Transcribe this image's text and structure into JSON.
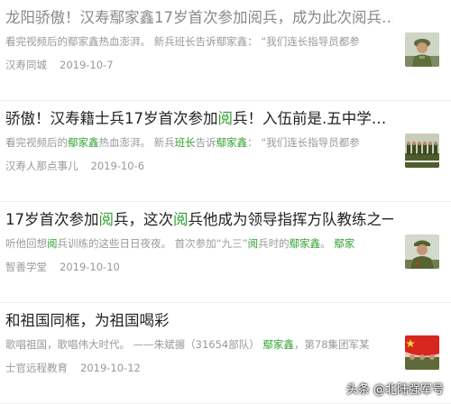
{
  "feed": {
    "items": [
      {
        "title_parts": [
          {
            "text": "龙阳骄傲！汉寿鄢家鑫17岁首次参加阅兵，成为此次阅兵…",
            "hl": false
          }
        ],
        "title_visited": true,
        "snippet_parts": [
          {
            "text": "看完视频后的鄢家鑫热血澎湃。  新兵班长告诉鄢家鑫：  “我们连长指导员都参",
            "hl": false
          }
        ],
        "source": "汉寿同城",
        "date": "2019-10-7",
        "thumb_icon": "soldier-photo-icon"
      },
      {
        "title_parts": [
          {
            "text": "骄傲！汉寿籍士兵17岁首次参加",
            "hl": false
          },
          {
            "text": "阅",
            "hl": true
          },
          {
            "text": "兵！入伍前是.五中学…",
            "hl": false
          }
        ],
        "title_visited": false,
        "snippet_parts": [
          {
            "text": "看完视频后的",
            "hl": false
          },
          {
            "text": "鄢家鑫",
            "hl": true
          },
          {
            "text": "热血澎湃。  新兵",
            "hl": false
          },
          {
            "text": "班长",
            "hl": true
          },
          {
            "text": "告诉",
            "hl": false
          },
          {
            "text": "鄢家鑫",
            "hl": true
          },
          {
            "text": "：  “我们连长指导员都参",
            "hl": false
          }
        ],
        "source": "汉寿人那点事儿",
        "date": "2019-10-6",
        "thumb_icon": "parade-formation-photo-icon"
      },
      {
        "title_parts": [
          {
            "text": "17岁首次参加",
            "hl": false
          },
          {
            "text": "阅",
            "hl": true
          },
          {
            "text": "兵，这次",
            "hl": false
          },
          {
            "text": "阅",
            "hl": true
          },
          {
            "text": "兵他成为领导指挥方队教练之一",
            "hl": false
          }
        ],
        "title_visited": false,
        "snippet_parts": [
          {
            "text": "听他回想",
            "hl": false
          },
          {
            "text": "阅",
            "hl": true
          },
          {
            "text": "兵训练的这些日日夜夜。  首次参加“九三”",
            "hl": false
          },
          {
            "text": "阅",
            "hl": true
          },
          {
            "text": "兵时的",
            "hl": false
          },
          {
            "text": "鄢家鑫",
            "hl": true
          },
          {
            "text": "。 ",
            "hl": false
          },
          {
            "text": "鄢家",
            "hl": true
          }
        ],
        "source": "智善学堂",
        "date": "2019-10-10",
        "thumb_icon": "soldier-portrait-photo-icon"
      },
      {
        "title_parts": [
          {
            "text": "和祖国同框，为祖国喝彩",
            "hl": false
          }
        ],
        "title_visited": false,
        "snippet_parts": [
          {
            "text": "歌唱祖国，歌唱伟大时代。  ——朱斌搌（31654部队）  ",
            "hl": false
          },
          {
            "text": "鄢家鑫",
            "hl": true
          },
          {
            "text": "，第78集团军某",
            "hl": false
          }
        ],
        "source": "士官远程教育",
        "date": "2019-10-12",
        "thumb_icon": "flag-ceremony-photo-icon"
      }
    ]
  },
  "watermark": "头条 @北陆强军号",
  "colors": {
    "highlight": "#2fa12f",
    "title": "#222222",
    "visited_title": "#888888",
    "meta": "#999999",
    "divider": "#eeeeee"
  }
}
